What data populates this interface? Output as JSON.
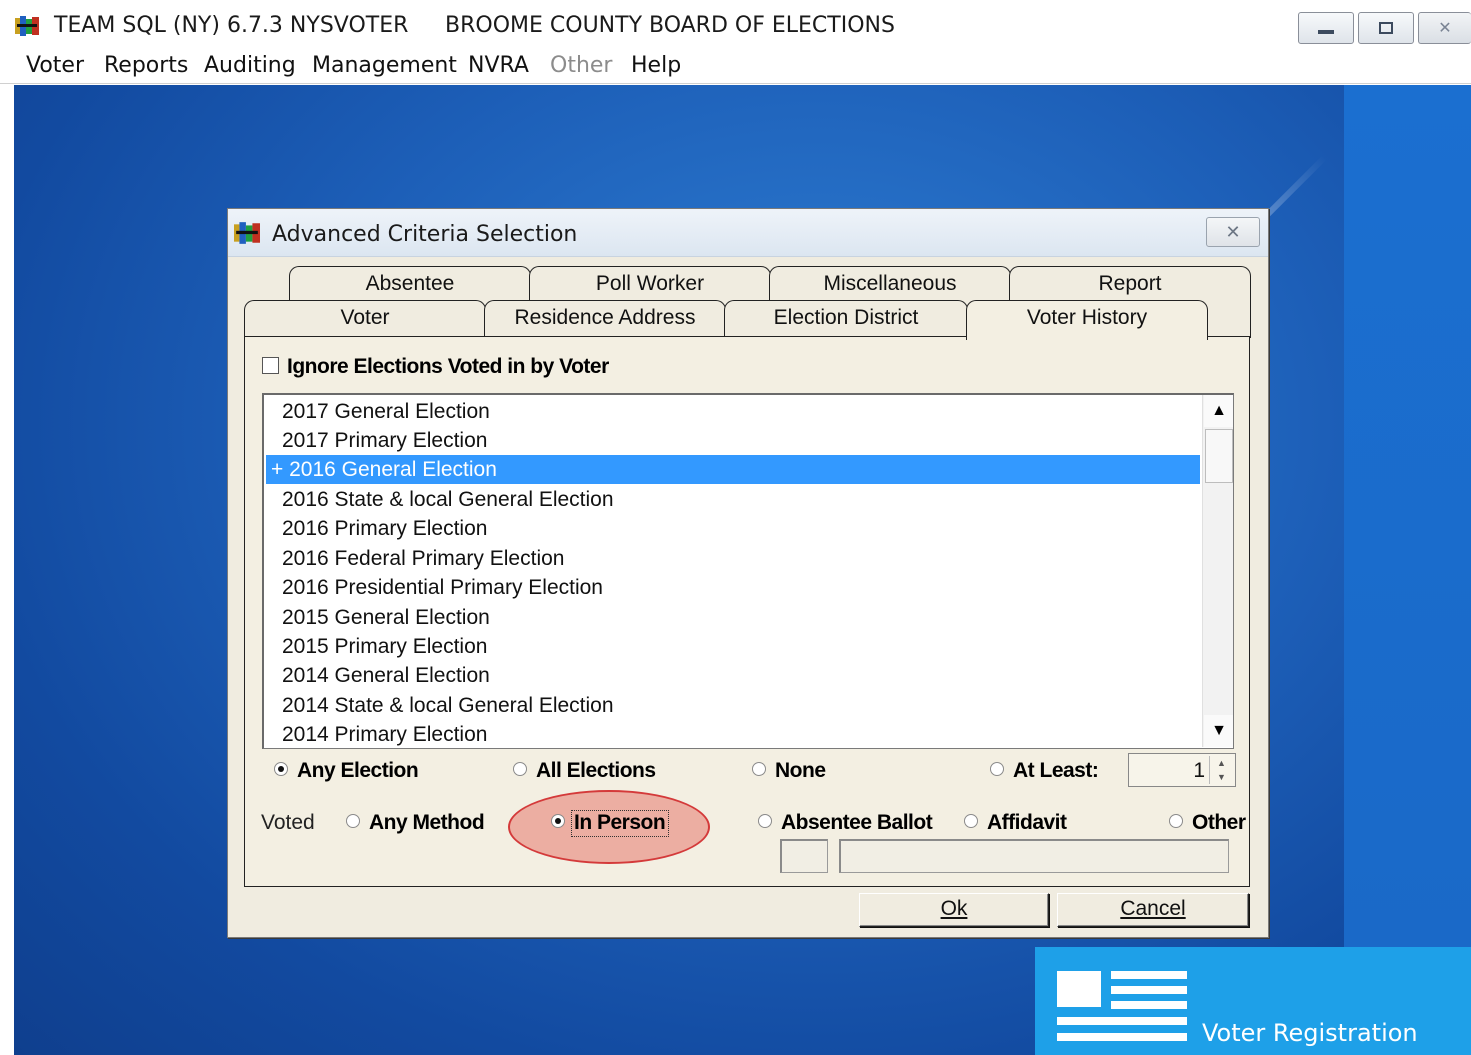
{
  "window": {
    "title": "TEAM SQL (NY) 6.7.3 NYSVOTER",
    "subtitle": "BROOME COUNTY BOARD OF ELECTIONS",
    "controls": {
      "minimize": "▭",
      "maximize": "▣",
      "close": "✕"
    }
  },
  "menu": [
    "Voter",
    "Reports",
    "Auditing",
    "Management",
    "NVRA",
    "Other",
    "Help"
  ],
  "dialog": {
    "title": "Advanced Criteria Selection",
    "close": "✕",
    "tabs_back": [
      "Absentee",
      "Poll Worker",
      "Miscellaneous",
      "Report"
    ],
    "tabs_front": [
      "Voter",
      "Residence Address",
      "Election District",
      "Voter History"
    ],
    "active_tab": "Voter History",
    "ignore_label": "Ignore Elections Voted in by Voter",
    "ignore_checked": false,
    "elections": [
      "2017 General Election",
      "2017 Primary Election",
      "+ 2016 General Election",
      "2016 State & local General Election",
      "2016 Primary Election",
      "2016 Federal Primary Election",
      "2016 Presidential Primary Election",
      "2015 General Election",
      "2015 Primary Election",
      "2014 General Election",
      "2014 State & local General Election",
      "2014 Primary Election"
    ],
    "selected_election": "+ 2016 General Election",
    "election_options": {
      "any": "Any Election",
      "all": "All Elections",
      "none": "None",
      "at_least": "At Least:",
      "selected": "Any Election",
      "at_least_value": "1"
    },
    "voted_label": "Voted",
    "method_options": {
      "any": "Any Method",
      "in_person": "In Person",
      "absentee": "Absentee Ballot",
      "affidavit": "Affidavit",
      "other": "Other",
      "selected": "In Person"
    },
    "ok_label": "Ok",
    "cancel_label": "Cancel"
  },
  "desktop": {
    "tile_label": "Voter Registration"
  },
  "colors": {
    "selection": "#3399ff",
    "highlight": "#d43a3a",
    "tile": "#1ea0e8"
  }
}
